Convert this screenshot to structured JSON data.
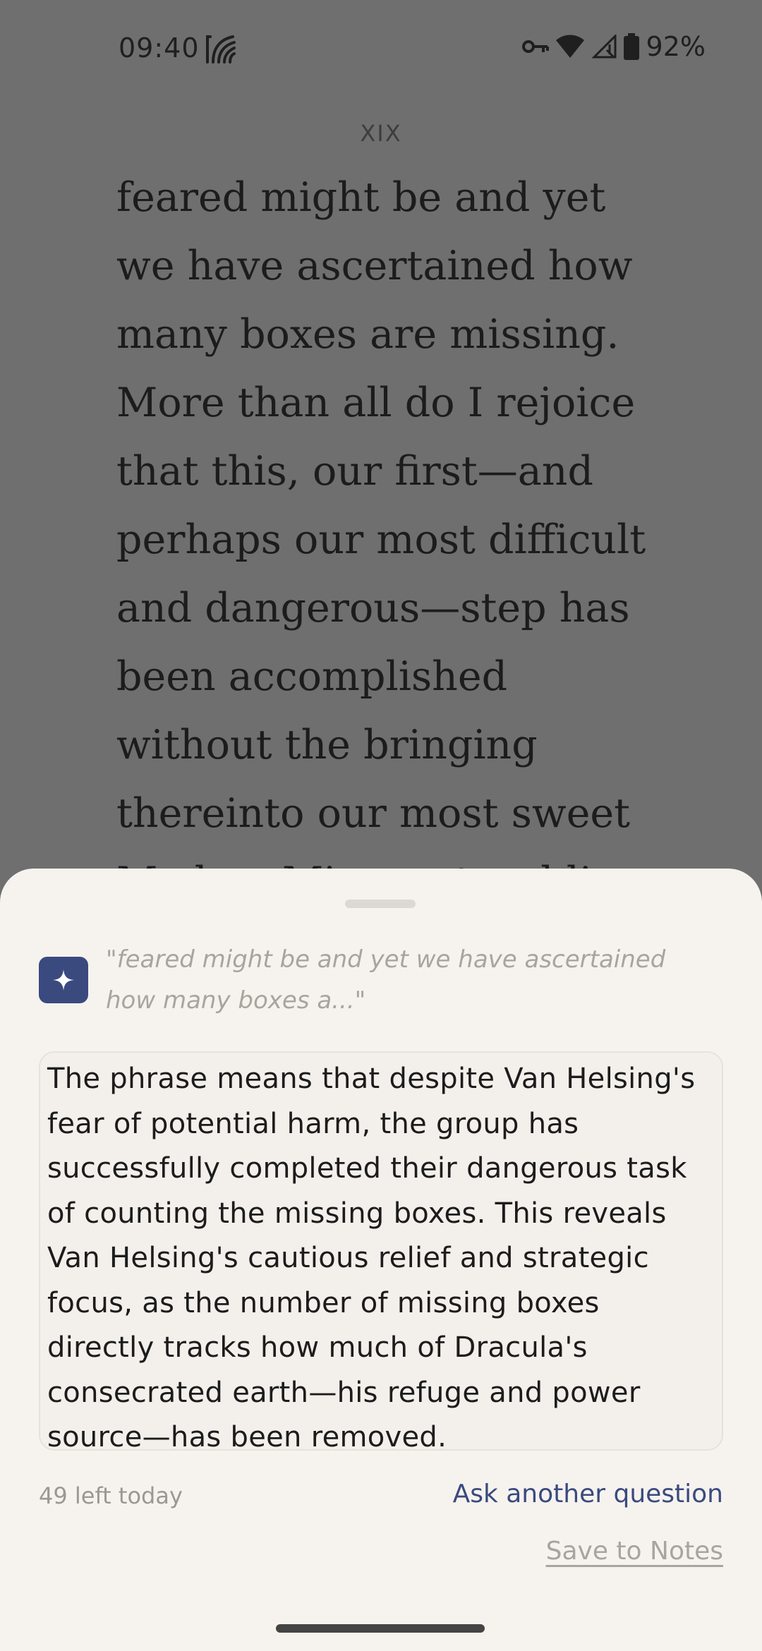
{
  "status_bar": {
    "time": "09:40",
    "battery": "92%",
    "icons": [
      "app-notification-icon",
      "vpn-key-icon",
      "wifi-icon",
      "cellular-signal-icon",
      "battery-icon"
    ]
  },
  "reader": {
    "chapter": "XIX",
    "lines": [
      "feared might be and yet",
      "we have ascertained how",
      "many boxes are missing.",
      "More than all do I rejoice",
      "that this, our first—and",
      "perhaps our most difficult",
      "and dangerous—step has",
      "been accomplished",
      "without the bringing",
      "thereinto our most sweet",
      "Madam Mina or troubling"
    ]
  },
  "sheet": {
    "ai_icon": "sparkle-icon",
    "quote": "\"feared might be and yet we have ascertained how many boxes a...\"",
    "answer": "The phrase means that despite Van Helsing's fear of potential harm, the group has successfully completed their dangerous task of counting the missing boxes. This reveals Van Helsing's cautious relief and strategic focus, as the number of missing boxes directly tracks how much of Dracula's consecrated earth—his refuge and power source—has been removed.",
    "remaining": "49 left today",
    "ask_another_label": "Ask another question",
    "save_label": "Save to Notes"
  },
  "colors": {
    "accent": "#3a4a7f",
    "sheet_background": "#f6f3ee",
    "dim_overlay": "#6f6f6f"
  }
}
